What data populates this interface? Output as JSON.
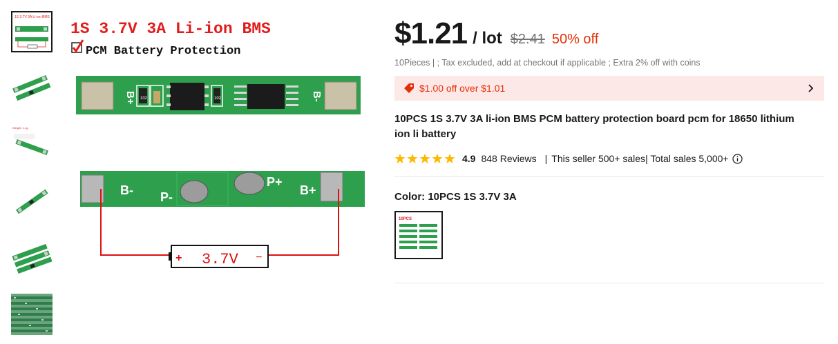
{
  "thumbnails": [
    {
      "name": "thumb-1",
      "label": "1S 3.7V 3A Li-ion BMS"
    },
    {
      "name": "thumb-2"
    },
    {
      "name": "thumb-3",
      "label": "Weight: 1.1g"
    },
    {
      "name": "thumb-4"
    },
    {
      "name": "thumb-5"
    },
    {
      "name": "thumb-6"
    }
  ],
  "main_image": {
    "headline": "1S 3.7V 3A Li-ion BMS",
    "subheadline": "PCM Battery Protection",
    "label_b_plus_top": "B+",
    "label_b_minus_top": "B-",
    "label_b_minus": "B-",
    "label_p_minus": "P-",
    "label_p_plus": "P+",
    "label_b_plus": "B+",
    "battery_plus": "+",
    "battery_voltage": "3.7V",
    "battery_minus": "−",
    "chip_marking_1": "102",
    "chip_marking_2": "102"
  },
  "price": {
    "current": "$1.21",
    "unit": "/ lot",
    "original": "$2.41",
    "discount": "50% off",
    "subline": "10Pieces | ; Tax excluded, add at checkout if applicable ; Extra 2% off with coins"
  },
  "coupon": {
    "text": "$1.00 off over $1.01"
  },
  "product": {
    "title": "10PCS 1S 3.7V 3A li-ion BMS PCM battery protection board pcm for 18650 lithium ion li battery"
  },
  "rating": {
    "score": "4.9",
    "stars": 5,
    "reviews": "848 Reviews",
    "separator": "|",
    "seller_sales": "This seller 500+ sales",
    "total_sales": "| Total sales 5,000+"
  },
  "variant": {
    "label": "Color: 10PCS 1S 3.7V 3A",
    "swatch_text": "10PCS"
  },
  "colors": {
    "accent": "#e62e04",
    "star": "#fcb900",
    "pcb_green": "#2e9f4c",
    "coupon_bg": "#fde8e8"
  },
  "icons": {
    "coupon": "tag-icon",
    "coupon_arrow": "chevron-right-icon",
    "star": "star-icon",
    "info": "info-icon"
  }
}
